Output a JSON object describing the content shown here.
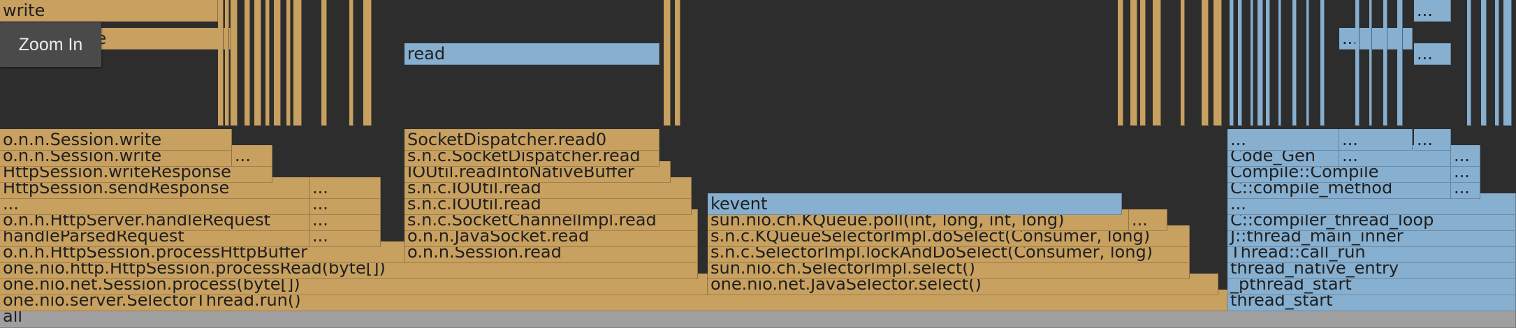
{
  "zoom_button": {
    "label": "Zoom In"
  },
  "frames": [
    {
      "text": "all",
      "kind": "root"
    },
    {
      "text": "one.nio.server.SelectorThread.run()",
      "kind": "java"
    },
    {
      "text": "thread_start",
      "kind": "native"
    },
    {
      "text": "one.nio.net.Session.process(byte[])",
      "kind": "java"
    },
    {
      "text": "one.nio.net.JavaSelector.select()",
      "kind": "java"
    },
    {
      "text": "_pthread_start",
      "kind": "native"
    },
    {
      "text": "one.nio.http.HttpSession.processRead(byte[])",
      "kind": "java"
    },
    {
      "text": "sun.nio.ch.SelectorImpl.select()",
      "kind": "java"
    },
    {
      "text": "thread_native_entry",
      "kind": "native"
    },
    {
      "text": "o.n.h.HttpSession.processHttpBuffer",
      "kind": "java"
    },
    {
      "text": "o.n.n.Session.read",
      "kind": "java"
    },
    {
      "text": "s.n.c.SelectorImpl.lockAndDoSelect(Consumer, long)",
      "kind": "java"
    },
    {
      "text": "Thread::call_run",
      "kind": "native"
    },
    {
      "text": "handleParsedRequest",
      "kind": "java"
    },
    {
      "text": "...",
      "kind": "java"
    },
    {
      "text": "o.n.n.JavaSocket.read",
      "kind": "java"
    },
    {
      "text": "s.n.c.KQueueSelectorImpl.doSelect(Consumer, long)",
      "kind": "java"
    },
    {
      "text": "J::thread_main_inner",
      "kind": "native"
    },
    {
      "text": "o.n.h.HttpServer.handleRequest",
      "kind": "java"
    },
    {
      "text": "...",
      "kind": "java"
    },
    {
      "text": "s.n.c.SocketChannelImpl.read",
      "kind": "java"
    },
    {
      "text": "sun.nio.ch.KQueue.poll(int, long, int, long)",
      "kind": "java"
    },
    {
      "text": "...",
      "kind": "java"
    },
    {
      "text": "C::compiler_thread_loop",
      "kind": "native"
    },
    {
      "text": "...",
      "kind": "java"
    },
    {
      "text": "...",
      "kind": "java"
    },
    {
      "text": "s.n.c.IOUtil.read",
      "kind": "java"
    },
    {
      "text": "kevent",
      "kind": "native"
    },
    {
      "text": "...",
      "kind": "native"
    },
    {
      "text": "HttpSession.sendResponse",
      "kind": "java"
    },
    {
      "text": "...",
      "kind": "java"
    },
    {
      "text": "s.n.c.IOUtil.read",
      "kind": "java"
    },
    {
      "text": "C::compile_method",
      "kind": "native"
    },
    {
      "text": "...",
      "kind": "native"
    },
    {
      "text": "HttpSession.writeResponse",
      "kind": "java"
    },
    {
      "text": "IOUtil.readIntoNativeBuffer",
      "kind": "java"
    },
    {
      "text": "Compile::Compile",
      "kind": "native"
    },
    {
      "text": "...",
      "kind": "native"
    },
    {
      "text": "o.n.n.Session.write",
      "kind": "java"
    },
    {
      "text": "...",
      "kind": "java"
    },
    {
      "text": "s.n.c.SocketDispatcher.read",
      "kind": "java"
    },
    {
      "text": "Code_Gen",
      "kind": "native"
    },
    {
      "text": "...",
      "kind": "native"
    },
    {
      "text": "...",
      "kind": "native"
    },
    {
      "text": "o.n.n.Session.write",
      "kind": "java"
    },
    {
      "text": "SocketDispatcher.read0",
      "kind": "java"
    },
    {
      "text": "...",
      "kind": "native"
    },
    {
      "text": "...",
      "kind": "native"
    },
    {
      "text": "...",
      "kind": "native"
    },
    {
      "text": "read",
      "kind": "native"
    },
    {
      "text": "...",
      "kind": "native"
    },
    {
      "text": "Socket.write",
      "kind": "java"
    },
    {
      "text": "...",
      "kind": "native"
    },
    {
      "text": "write",
      "kind": "java"
    },
    {
      "text": "...",
      "kind": "native"
    },
    {
      "text": "",
      "kind": "java"
    },
    {
      "text": "",
      "kind": "java"
    },
    {
      "text": "",
      "kind": "java"
    },
    {
      "text": "",
      "kind": "java"
    },
    {
      "text": "",
      "kind": "java"
    },
    {
      "text": "",
      "kind": "java"
    },
    {
      "text": "",
      "kind": "java"
    },
    {
      "text": "",
      "kind": "java"
    },
    {
      "text": "",
      "kind": "java"
    },
    {
      "text": "",
      "kind": "java"
    },
    {
      "text": "",
      "kind": "java"
    },
    {
      "text": "",
      "kind": "java"
    },
    {
      "text": "",
      "kind": "java"
    },
    {
      "text": "",
      "kind": "java"
    },
    {
      "text": "",
      "kind": "java"
    },
    {
      "text": "",
      "kind": "java"
    },
    {
      "text": "",
      "kind": "java"
    },
    {
      "text": "",
      "kind": "java"
    },
    {
      "text": "",
      "kind": "java"
    },
    {
      "text": "",
      "kind": "java"
    },
    {
      "text": "",
      "kind": "java"
    },
    {
      "text": "",
      "kind": "native"
    },
    {
      "text": "",
      "kind": "native"
    },
    {
      "text": "",
      "kind": "native"
    },
    {
      "text": "",
      "kind": "native"
    },
    {
      "text": "",
      "kind": "native"
    },
    {
      "text": "",
      "kind": "native"
    },
    {
      "text": "",
      "kind": "native"
    },
    {
      "text": "",
      "kind": "native"
    },
    {
      "text": "",
      "kind": "native"
    },
    {
      "text": "",
      "kind": "native"
    },
    {
      "text": "",
      "kind": "native"
    },
    {
      "text": "",
      "kind": "native"
    },
    {
      "text": "",
      "kind": "native"
    },
    {
      "text": "",
      "kind": "native"
    },
    {
      "text": "",
      "kind": "native"
    },
    {
      "text": "",
      "kind": "native"
    },
    {
      "text": "",
      "kind": "native"
    },
    {
      "text": "",
      "kind": "native"
    },
    {
      "text": "",
      "kind": "native"
    },
    {
      "text": "",
      "kind": "native"
    },
    {
      "text": "",
      "kind": "native"
    },
    {
      "text": "",
      "kind": "native"
    },
    {
      "text": "",
      "kind": "native"
    }
  ]
}
